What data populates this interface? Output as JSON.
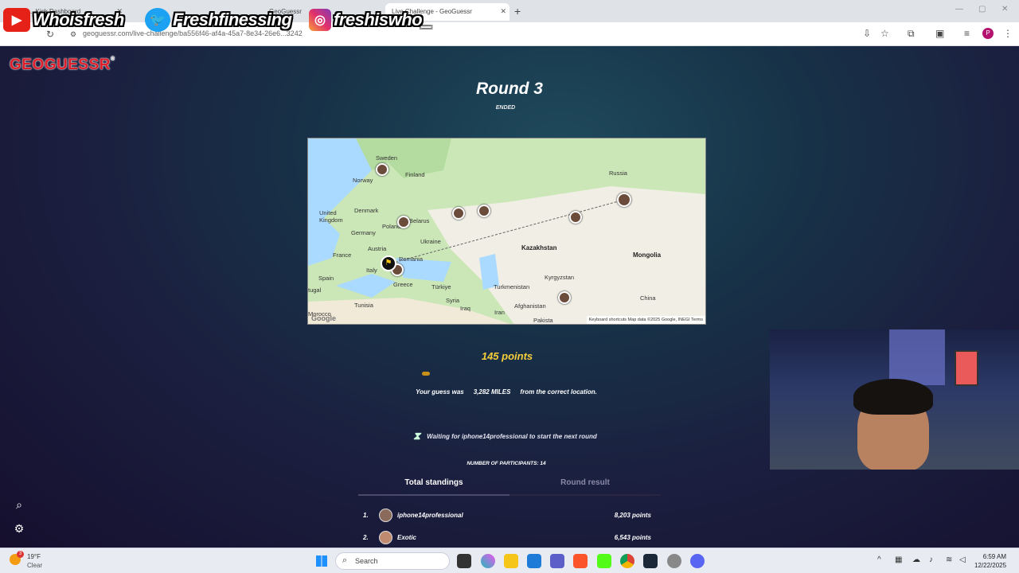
{
  "browser": {
    "tabs": [
      {
        "label": "...Kick Dashboard"
      },
      {
        "label": ""
      },
      {
        "label": "GeoGuessr"
      },
      {
        "label": "Live Challenge - GeoGuessr",
        "active": true
      }
    ],
    "url": "geoguessr.com/live-challenge/ba556f46-af4a-45a7-8e34-26e6...3242",
    "profile_initial": "P"
  },
  "overlay": {
    "youtube": "Whoisfresh",
    "twitter": "Freshfinessing",
    "instagram": "freshiswho_"
  },
  "game": {
    "logo": "GEOGUESSR",
    "logo_reg": "®",
    "round_title": "Round 3",
    "round_status": "ENDED",
    "points_text": "145 points",
    "points_fraction": 0.03,
    "distance_prefix": "Your guess was",
    "distance_value": "3,282 MILES",
    "distance_suffix": "from the correct location.",
    "waiting_text": "Waiting for iphone14professional to start the next round",
    "participants_text": "NUMBER OF PARTICIPANTS: 14",
    "tab_total": "Total standings",
    "tab_round": "Round result",
    "standings": [
      {
        "rank": "1.",
        "name": "iphone14professional",
        "points": "8,203 points"
      },
      {
        "rank": "2.",
        "name": "Exotic",
        "points": "6,543 points"
      }
    ]
  },
  "map": {
    "labels": {
      "sweden": "Sweden",
      "finland": "Finland",
      "russia": "Russia",
      "norway": "Norway",
      "uk": "United Kingdom",
      "denmark": "Denmark",
      "belarus": "Belarus",
      "poland": "Poland",
      "germany": "Germany",
      "ukraine": "Ukraine",
      "kazakhstan": "Kazakhstan",
      "mongolia": "Mongolia",
      "france": "France",
      "austria": "Austria",
      "romania": "Romania",
      "italy": "Italy",
      "spain": "Spain",
      "kyrgyzstan": "Kyrgyzstan",
      "greece": "Greece",
      "turkiye": "Türkiye",
      "turkmenistan": "Turkmenistan",
      "china": "China",
      "portugal": "tugal",
      "tunisia": "Tunisia",
      "syria": "Syria",
      "iraq": "Iraq",
      "afghanistan": "Afghanistan",
      "iran": "Iran",
      "morocco": "Morocco",
      "pakistan": "Pakista"
    },
    "footer": "Keyboard shortcuts   Map data ©2025 Google, INEGI   Terms",
    "google": "Google"
  },
  "taskbar": {
    "weather_temp": "19°F",
    "weather_cond": "Clear",
    "weather_badge": "3",
    "search_placeholder": "Search",
    "time": "6:59 AM",
    "date": "12/22/2025"
  },
  "colors": {
    "accent_points": "#f7cf3a",
    "logo_red": "#e01e2a"
  }
}
